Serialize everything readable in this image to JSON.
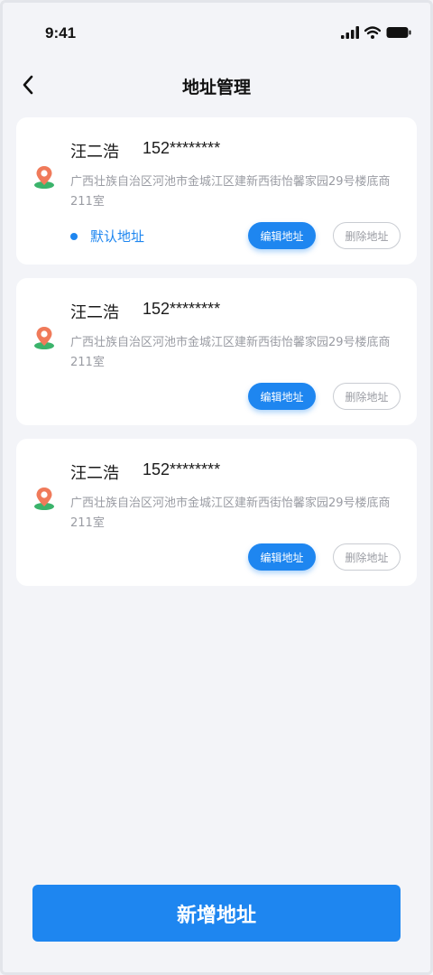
{
  "status_bar": {
    "time": "9:41"
  },
  "nav": {
    "title": "地址管理"
  },
  "addresses": [
    {
      "name": "汪二浩",
      "phone": "152********",
      "address": "广西壮族自治区河池市金城江区建新西街怡馨家园29号楼底商211室",
      "default_label": "默认地址",
      "edit_label": "编辑地址",
      "delete_label": "删除地址"
    },
    {
      "name": "汪二浩",
      "phone": "152********",
      "address": "广西壮族自治区河池市金城江区建新西街怡馨家园29号楼底商211室",
      "edit_label": "编辑地址",
      "delete_label": "删除地址"
    },
    {
      "name": "汪二浩",
      "phone": "152********",
      "address": "广西壮族自治区河池市金城江区建新西街怡馨家园29号楼底商211室",
      "edit_label": "编辑地址",
      "delete_label": "删除地址"
    }
  ],
  "footer": {
    "add_label": "新增地址"
  },
  "colors": {
    "accent": "#1e86f0",
    "pin_top": "#f07a5a",
    "pin_base": "#3bb36b",
    "background": "#f3f4f8"
  },
  "icons": [
    "back-arrow-icon",
    "signal-icon",
    "wifi-icon",
    "battery-icon",
    "location-pin-icon"
  ]
}
